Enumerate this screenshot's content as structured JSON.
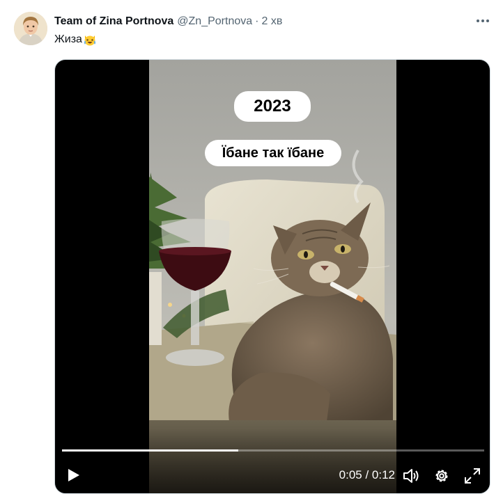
{
  "tweet": {
    "display_name": "Team of Zina Portnova",
    "handle": "@Zn_Portnova",
    "separator": "·",
    "time": "2 хв",
    "text": "Жиза",
    "emoji_icon": "laughing-crying-cat-emoji"
  },
  "video": {
    "overlay_year": "2023",
    "overlay_caption": "Їбане так їбане",
    "current_time": "0:05",
    "duration": "0:12",
    "time_separator": " / ",
    "progress_fraction": 0.4167,
    "controls": {
      "play_icon": "play-icon",
      "volume_icon": "volume-icon",
      "settings_icon": "gear-icon",
      "fullscreen_icon": "fullscreen-icon"
    }
  },
  "colors": {
    "text_primary": "#0f1419",
    "text_secondary": "#536471",
    "player_background": "#000000"
  }
}
